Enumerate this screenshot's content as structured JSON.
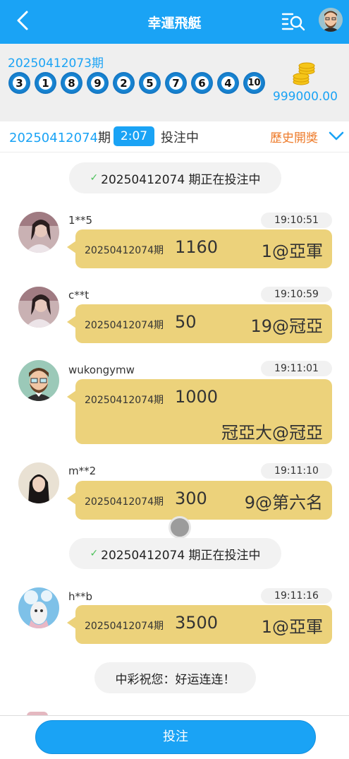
{
  "header": {
    "title": "幸運飛艇"
  },
  "draw": {
    "period": "20250412073期",
    "balls": [
      "3",
      "1",
      "8",
      "9",
      "2",
      "5",
      "7",
      "6",
      "4",
      "10"
    ],
    "balance": "999000.00"
  },
  "betbar": {
    "period_number": "20250412074",
    "period_suffix": "期",
    "countdown": "2:07",
    "status": "投注中",
    "history": "歷史開獎"
  },
  "system_message": "20250412074 期正在投注中",
  "chat": [
    {
      "user": "1**5",
      "time": "19:10:51",
      "period": "20250412074期",
      "amount": "1160",
      "target": "1@亞軍"
    },
    {
      "user": "c**t",
      "time": "19:10:59",
      "period": "20250412074期",
      "amount": "50",
      "target": "19@冠亞"
    },
    {
      "user": "wukongymw",
      "time": "19:11:01",
      "period": "20250412074期",
      "amount": "1000",
      "target": "冠亞大@冠亞"
    },
    {
      "user": "m**2",
      "time": "19:11:10",
      "period": "20250412074期",
      "amount": "300",
      "target": "9@第六名"
    },
    {
      "user": "h**b",
      "time": "19:11:16",
      "period": "20250412074期",
      "amount": "3500",
      "target": "1@亞軍"
    }
  ],
  "cheer": "中彩祝您：好运连连！",
  "footer": {
    "bet_button": "投注"
  }
}
